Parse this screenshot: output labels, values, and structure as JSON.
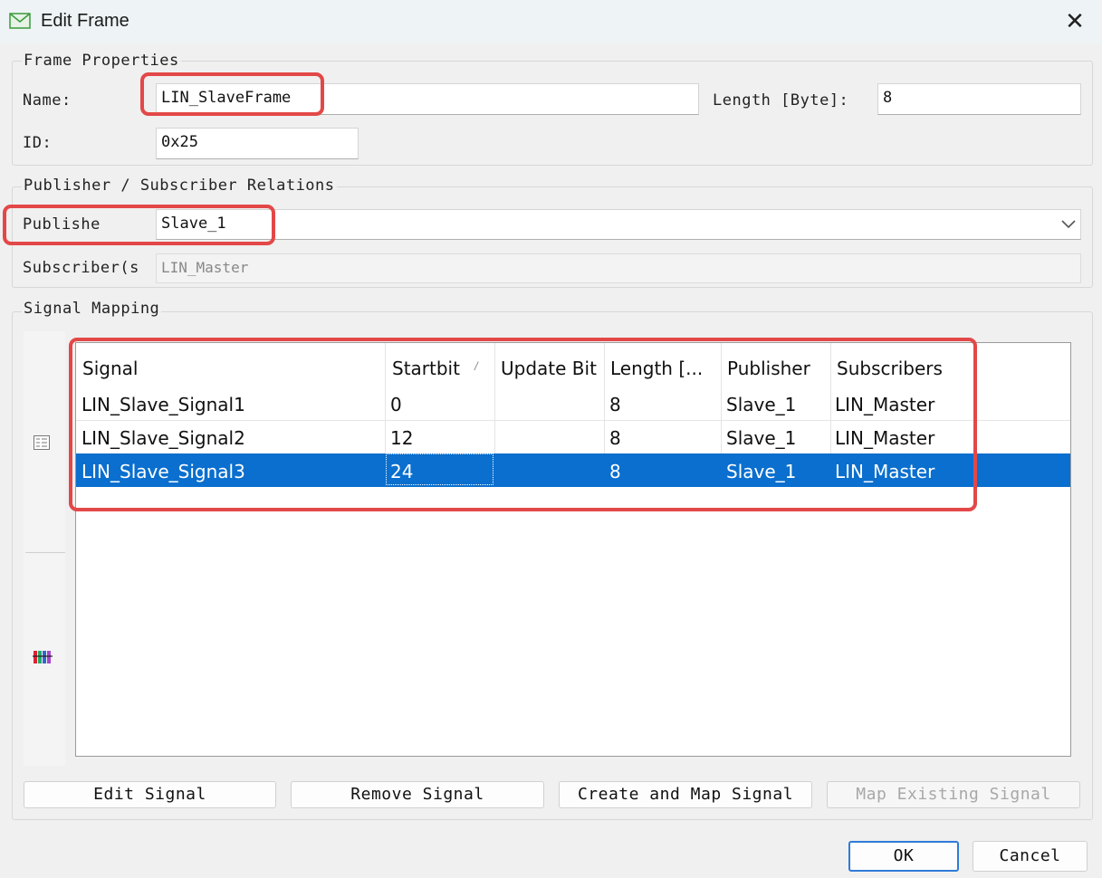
{
  "window": {
    "title": "Edit Frame",
    "close_glyph": "✕",
    "icon": "envelope-icon"
  },
  "frame_properties": {
    "legend": "Frame Properties",
    "name_label": "Name:",
    "name_value": "LIN_SlaveFrame",
    "length_label": "Length [Byte]:",
    "length_value": "8",
    "id_label": "ID:",
    "id_value": "0x25"
  },
  "relations": {
    "legend": "Publisher / Subscriber Relations",
    "publisher_label": "Publishe",
    "publisher_value": "Slave_1",
    "subscriber_label": "Subscriber(s",
    "subscriber_value": "LIN_Master"
  },
  "signal_mapping": {
    "legend": "Signal Mapping",
    "columns": [
      "Signal",
      "Startbit",
      "Update Bit",
      "Length [...",
      "Publisher",
      "Subscribers"
    ],
    "sort_glyph": "/",
    "rows": [
      {
        "signal": "LIN_Slave_Signal1",
        "startbit": "0",
        "update_bit": "",
        "length": "8",
        "publisher": "Slave_1",
        "subscribers": "LIN_Master"
      },
      {
        "signal": "LIN_Slave_Signal2",
        "startbit": "12",
        "update_bit": "",
        "length": "8",
        "publisher": "Slave_1",
        "subscribers": "LIN_Master"
      },
      {
        "signal": "LIN_Slave_Signal3",
        "startbit": "24",
        "update_bit": "",
        "length": "8",
        "publisher": "Slave_1",
        "subscribers": "LIN_Master"
      }
    ],
    "selected_row": 3,
    "selection_color": "#0a6fce"
  },
  "buttons": {
    "edit": "Edit Signal",
    "remove": "Remove Signal",
    "create": "Create and Map Signal",
    "map_existing": "Map Existing Signal"
  },
  "footer": {
    "ok": "OK",
    "cancel": "Cancel"
  },
  "highlight_color": "#e34848"
}
